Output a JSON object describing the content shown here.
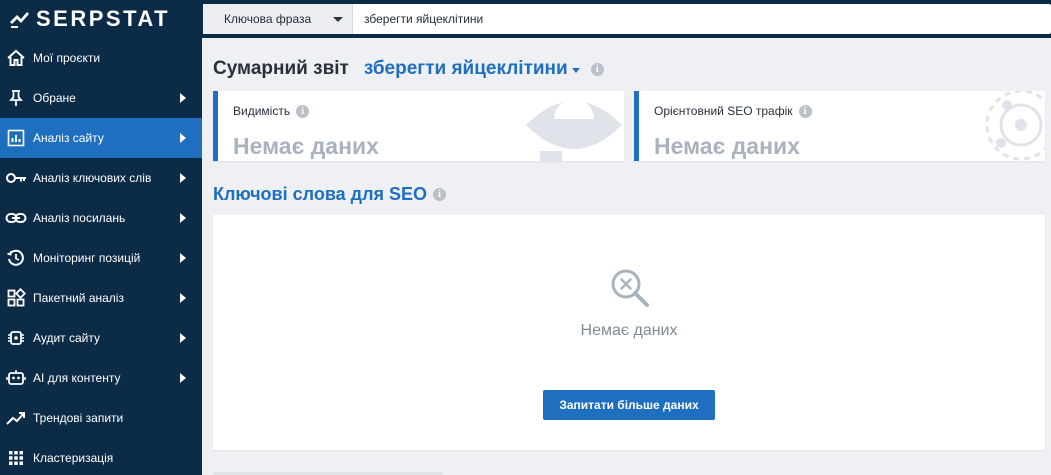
{
  "app": {
    "logo_text": "SERPSTAT"
  },
  "search": {
    "type_label": "Ключова фраза",
    "query": "зберегти яйцеклітини"
  },
  "sidebar": {
    "items": [
      {
        "label": "Мої проєкти",
        "icon": "home-icon"
      },
      {
        "label": "Обране",
        "icon": "pin-icon"
      },
      {
        "label": "Аналіз сайту",
        "icon": "bar-chart-icon",
        "active": true
      },
      {
        "label": "Аналіз ключових слів",
        "icon": "key-icon"
      },
      {
        "label": "Аналіз посилань",
        "icon": "link-icon"
      },
      {
        "label": "Моніторинг позицій",
        "icon": "history-icon"
      },
      {
        "label": "Пакетний аналіз",
        "icon": "grid-icon"
      },
      {
        "label": "Аудит сайту",
        "icon": "audit-chip-icon"
      },
      {
        "label": "AI для контенту",
        "icon": "robot-icon"
      },
      {
        "label": "Трендові запити",
        "icon": "trend-icon"
      },
      {
        "label": "Кластеризація",
        "icon": "cluster-grid-icon"
      }
    ]
  },
  "main": {
    "title": "Сумарний звіт",
    "keyword": "зберегти яйцеклітини",
    "cards": [
      {
        "label": "Видимість",
        "value": "Немає даних"
      },
      {
        "label": "Орієнтовний SEO трафік",
        "value": "Немає даних"
      }
    ],
    "section_title": "Ключові слова для SEO",
    "empty_text": "Немає даних",
    "more_button": "Запитати більше даних"
  },
  "colors": {
    "sidebar_bg": "#0b2b46",
    "accent": "#1e6fc0",
    "muted_value": "#a9b3bf"
  }
}
